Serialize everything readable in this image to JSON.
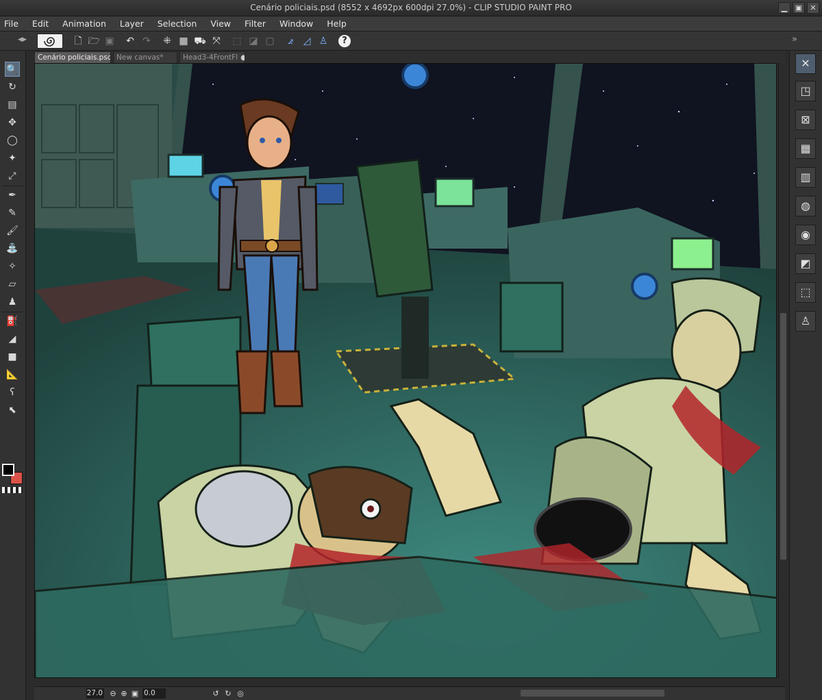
{
  "window": {
    "title": "Cenário policiais.psd (8552 x 4692px 600dpi 27.0%)  - CLIP STUDIO PAINT PRO",
    "minimize": "▁",
    "maximize": "▣",
    "close": "✕"
  },
  "menu": {
    "items": [
      "File",
      "Edit",
      "Animation",
      "Layer",
      "Selection",
      "View",
      "Filter",
      "Window",
      "Help"
    ]
  },
  "toolbar": {
    "collapse_left": "◂▸",
    "collapse_right": "»",
    "help": "?"
  },
  "tabs": [
    {
      "label": "Cenário policiais.psd",
      "close": "✕"
    },
    {
      "label": "New canvas*",
      "close": "●"
    },
    {
      "label": "Head3-4FrontFl",
      "close": "●"
    }
  ],
  "status": {
    "zoom": "27.0",
    "angle": "0.0"
  },
  "colors": {
    "main": "#000000",
    "sub": "#d9534a",
    "accent": "#5a6b7d"
  }
}
